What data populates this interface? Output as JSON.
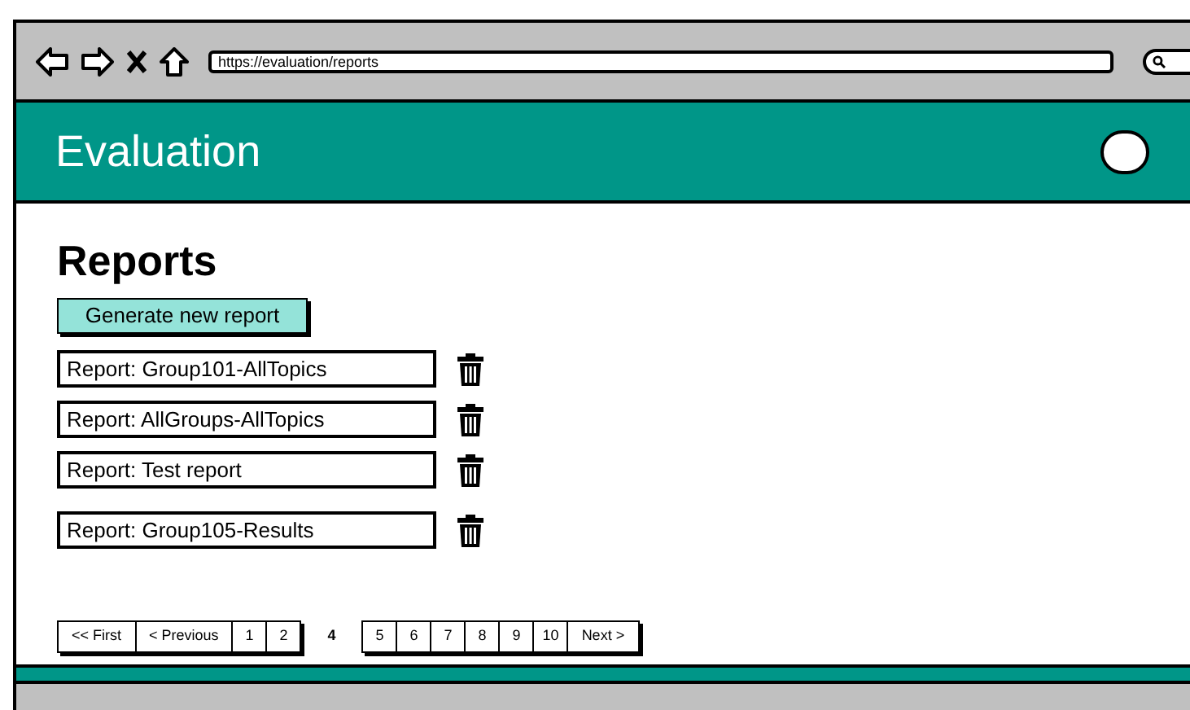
{
  "browser": {
    "url": "https://evaluation/reports"
  },
  "header": {
    "title": "Evaluation"
  },
  "page": {
    "title": "Reports",
    "primary_button": "Generate new report"
  },
  "reports": [
    {
      "label": "Report: Group101-AllTopics"
    },
    {
      "label": "Report: AllGroups-AllTopics"
    },
    {
      "label": "Report: Test report"
    },
    {
      "label": "Report: Group105-Results"
    }
  ],
  "pagination": [
    {
      "label": "<< First",
      "selected": false
    },
    {
      "label": "< Previous",
      "selected": false
    },
    {
      "label": "1",
      "selected": false
    },
    {
      "label": "2",
      "selected": false
    },
    {
      "label": "4",
      "selected": true
    },
    {
      "label": "5",
      "selected": false
    },
    {
      "label": "6",
      "selected": false
    },
    {
      "label": "7",
      "selected": false
    },
    {
      "label": "8",
      "selected": false
    },
    {
      "label": "9",
      "selected": false
    },
    {
      "label": "10",
      "selected": false
    },
    {
      "label": "Next >",
      "selected": false
    }
  ]
}
